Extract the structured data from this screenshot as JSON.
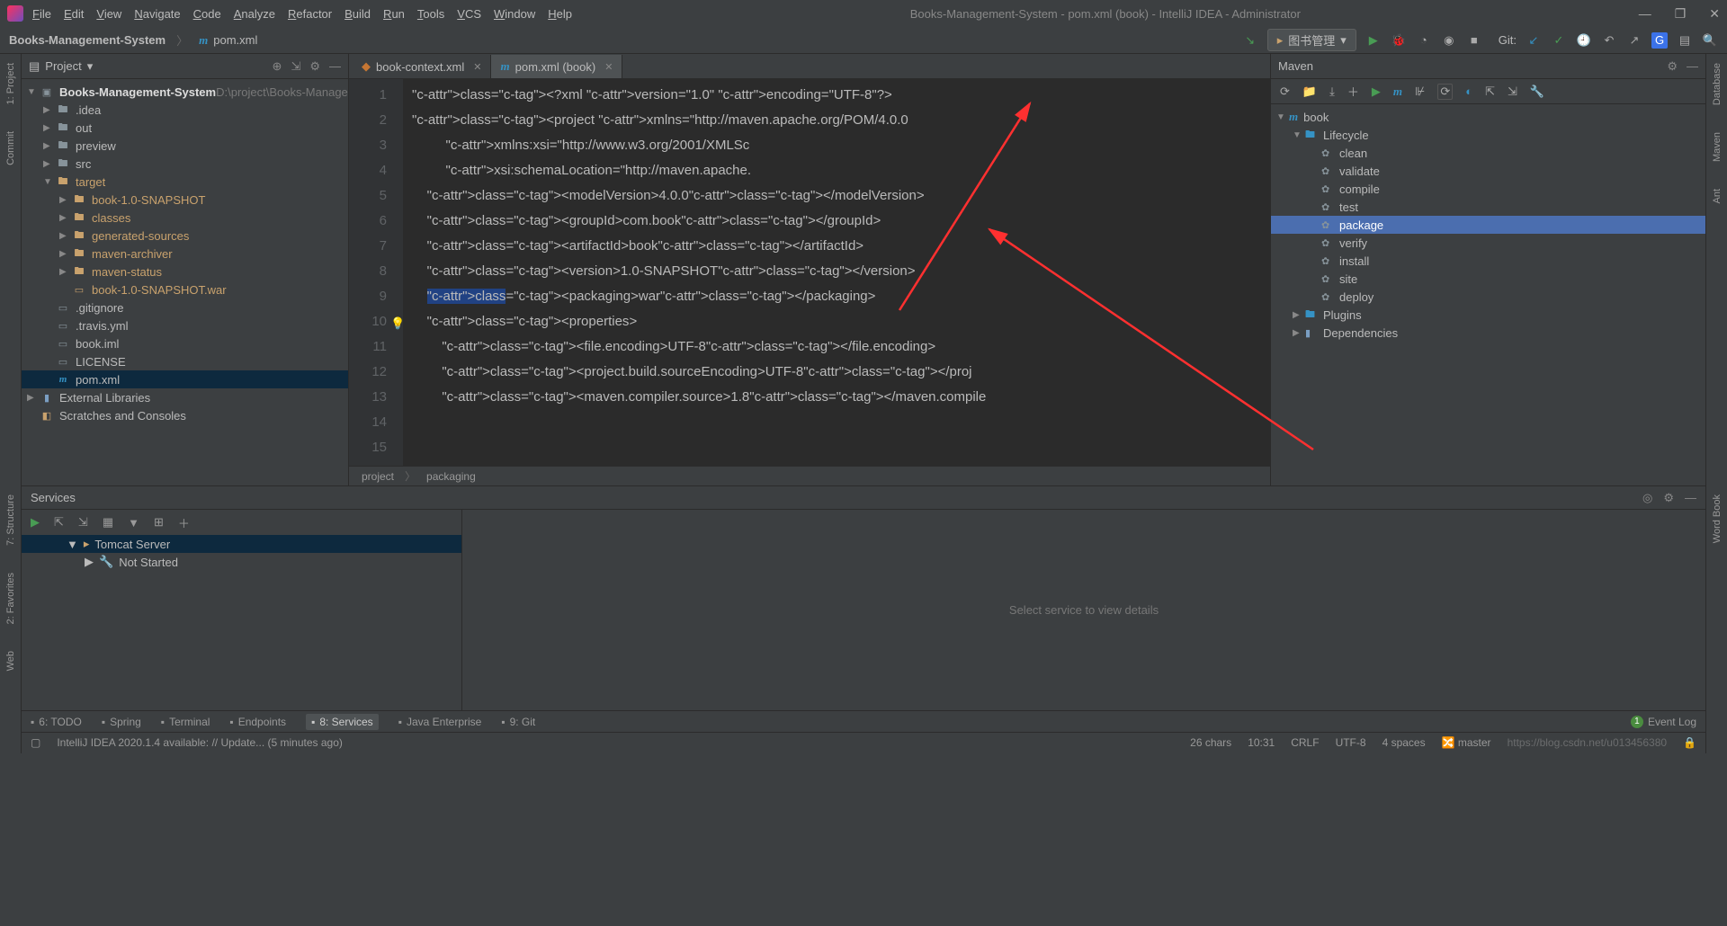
{
  "window": {
    "title": "Books-Management-System - pom.xml (book) - IntelliJ IDEA - Administrator",
    "menus": [
      "File",
      "Edit",
      "View",
      "Navigate",
      "Code",
      "Analyze",
      "Refactor",
      "Build",
      "Run",
      "Tools",
      "VCS",
      "Window",
      "Help"
    ]
  },
  "breadcrumb": {
    "project": "Books-Management-System",
    "file": "pom.xml"
  },
  "runconfig": {
    "label": "图书管理",
    "git_label": "Git:"
  },
  "project_panel": {
    "title": "Project",
    "root": "Books-Management-System",
    "root_path": "D:\\project\\Books-Manage",
    "nodes": [
      {
        "label": ".idea",
        "depth": 1,
        "kind": "folder",
        "expanded": false
      },
      {
        "label": "out",
        "depth": 1,
        "kind": "folder",
        "expanded": false
      },
      {
        "label": "preview",
        "depth": 1,
        "kind": "folder",
        "expanded": false
      },
      {
        "label": "src",
        "depth": 1,
        "kind": "folder",
        "expanded": false
      },
      {
        "label": "target",
        "depth": 1,
        "kind": "folder-orange",
        "expanded": true
      },
      {
        "label": "book-1.0-SNAPSHOT",
        "depth": 2,
        "kind": "folder-orange",
        "expanded": false
      },
      {
        "label": "classes",
        "depth": 2,
        "kind": "folder-orange",
        "expanded": false
      },
      {
        "label": "generated-sources",
        "depth": 2,
        "kind": "folder-orange",
        "expanded": false
      },
      {
        "label": "maven-archiver",
        "depth": 2,
        "kind": "folder-orange",
        "expanded": false
      },
      {
        "label": "maven-status",
        "depth": 2,
        "kind": "folder-orange",
        "expanded": false
      },
      {
        "label": "book-1.0-SNAPSHOT.war",
        "depth": 2,
        "kind": "file-orange",
        "expanded": null
      },
      {
        "label": ".gitignore",
        "depth": 1,
        "kind": "file",
        "expanded": null
      },
      {
        "label": ".travis.yml",
        "depth": 1,
        "kind": "file",
        "expanded": null
      },
      {
        "label": "book.iml",
        "depth": 1,
        "kind": "file",
        "expanded": null
      },
      {
        "label": "LICENSE",
        "depth": 1,
        "kind": "file",
        "expanded": null
      },
      {
        "label": "pom.xml",
        "depth": 1,
        "kind": "file-m",
        "expanded": null,
        "selected": true
      }
    ],
    "ext_libs": "External Libraries",
    "scratches": "Scratches and Consoles"
  },
  "tabs": [
    {
      "label": "book-context.xml",
      "active": false,
      "icon": "xml"
    },
    {
      "label": "pom.xml (book)",
      "active": true,
      "icon": "m"
    }
  ],
  "code": {
    "lines": [
      {
        "n": 1,
        "xml": "<?xml version=\"1.0\" encoding=\"UTF-8\"?>"
      },
      {
        "n": 2,
        "xml": "<project xmlns=\"http://maven.apache.org/POM/4.0.0"
      },
      {
        "n": 3,
        "xml": "         xmlns:xsi=\"http://www.w3.org/2001/XMLSc"
      },
      {
        "n": 4,
        "xml": "         xsi:schemaLocation=\"http://maven.apache."
      },
      {
        "n": 5,
        "xml": "    <modelVersion>4.0.0</modelVersion>"
      },
      {
        "n": 6,
        "xml": ""
      },
      {
        "n": 7,
        "xml": "    <groupId>com.book</groupId>"
      },
      {
        "n": 8,
        "xml": "    <artifactId>book</artifactId>"
      },
      {
        "n": 9,
        "xml": "    <version>1.0-SNAPSHOT</version>"
      },
      {
        "n": 10,
        "xml": "    <packaging>war</packaging>",
        "hl": true
      },
      {
        "n": 11,
        "xml": ""
      },
      {
        "n": 12,
        "xml": "    <properties>"
      },
      {
        "n": 13,
        "xml": "        <file.encoding>UTF-8</file.encoding>"
      },
      {
        "n": 14,
        "xml": "        <project.build.sourceEncoding>UTF-8</proj"
      },
      {
        "n": 15,
        "xml": "        <maven.compiler.source>1.8</maven.compile"
      }
    ],
    "crumb_left": "project",
    "crumb_right": "packaging"
  },
  "maven": {
    "title": "Maven",
    "root": "book",
    "lifecycle_label": "Lifecycle",
    "lifecycle": [
      "clean",
      "validate",
      "compile",
      "test",
      "package",
      "verify",
      "install",
      "site",
      "deploy"
    ],
    "selected": "package",
    "plugins": "Plugins",
    "deps": "Dependencies"
  },
  "left_gutter": [
    "1: Project",
    "Commit"
  ],
  "left_gutter2": [
    "7: Structure",
    "2: Favorites",
    "Web"
  ],
  "right_gutter": [
    "Database",
    "Maven",
    "Ant",
    "Word Book"
  ],
  "services": {
    "title": "Services",
    "tomcat": "Tomcat Server",
    "notstarted": "Not Started",
    "placeholder": "Select service to view details"
  },
  "bottom_tabs": [
    "6: TODO",
    "Spring",
    "Terminal",
    "Endpoints",
    "8: Services",
    "Java Enterprise",
    "9: Git"
  ],
  "bottom_active": "8: Services",
  "event_log": "Event Log",
  "statusbar": {
    "msg": "IntelliJ IDEA 2020.1.4 available: // Update... (5 minutes ago)",
    "chars": "26 chars",
    "pos": "10:31",
    "eol": "CRLF",
    "enc": "UTF-8",
    "indent": "4 spaces",
    "branch": "master",
    "watermark": "https://blog.csdn.net/u013456380"
  }
}
